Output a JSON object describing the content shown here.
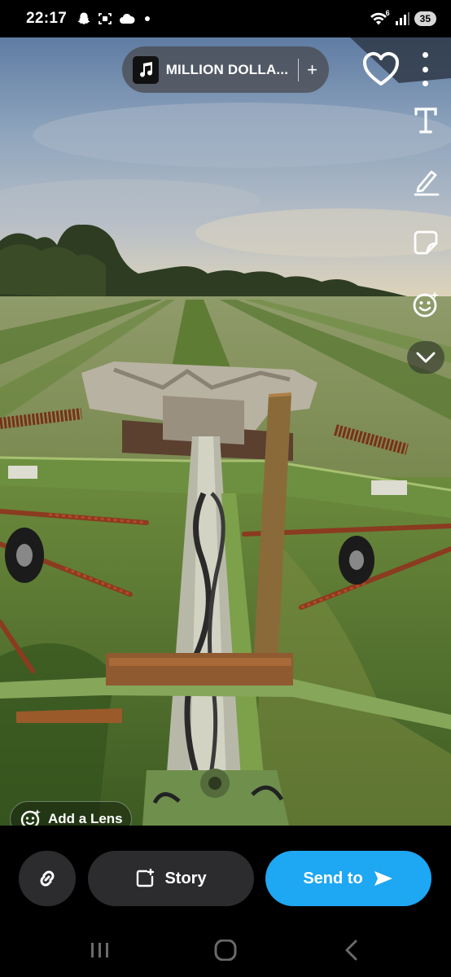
{
  "status_bar": {
    "time": "22:17",
    "left_icons": [
      "snapchat-ghost-icon",
      "screen-record-icon",
      "cloud-icon",
      "dot-icon"
    ],
    "wifi_badge": "6",
    "battery": "35"
  },
  "music": {
    "title": "MILLION DOLLA...",
    "add_symbol": "+"
  },
  "top_actions": [
    "heart-icon",
    "more-vertical-icon"
  ],
  "tools": [
    "text-tool-icon",
    "pen-tool-icon",
    "sticker-tool-icon",
    "emoji-tool-icon",
    "chevron-down-icon"
  ],
  "lens": {
    "label": "Add a Lens"
  },
  "bottom": {
    "story_label": "Story",
    "send_label": "Send to"
  },
  "nav": [
    "recents-icon",
    "home-icon",
    "back-icon"
  ],
  "colors": {
    "send_button": "#1ea7f3",
    "secondary_button": "#2c2c2e",
    "pill_background": "#46464b"
  }
}
